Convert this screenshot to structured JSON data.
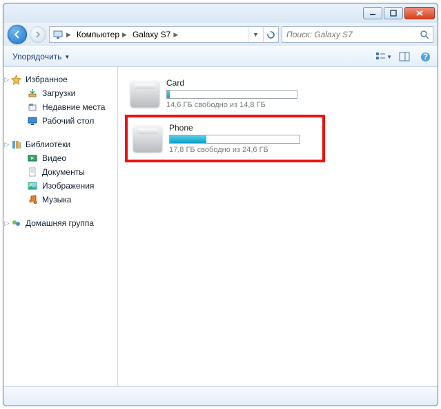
{
  "breadcrumb": {
    "item1": "Компьютер",
    "item2": "Galaxy S7"
  },
  "search": {
    "placeholder": "Поиск: Galaxy S7"
  },
  "toolbar": {
    "organize": "Упорядочить"
  },
  "sidebar": {
    "favorites": {
      "label": "Избранное",
      "downloads": "Загрузки",
      "recent": "Недавние места",
      "desktop": "Рабочий стол"
    },
    "libraries": {
      "label": "Библиотеки",
      "video": "Видео",
      "documents": "Документы",
      "pictures": "Изображения",
      "music": "Музыка"
    },
    "homegroup": {
      "label": "Домашняя группа"
    }
  },
  "drives": {
    "card": {
      "name": "Card",
      "sub": "14,6 ГБ свободно из 14,8 ГБ",
      "fill_pct": 2
    },
    "phone": {
      "name": "Phone",
      "sub": "17,8 ГБ свободно из 24,6 ГБ",
      "fill_pct": 28
    }
  }
}
